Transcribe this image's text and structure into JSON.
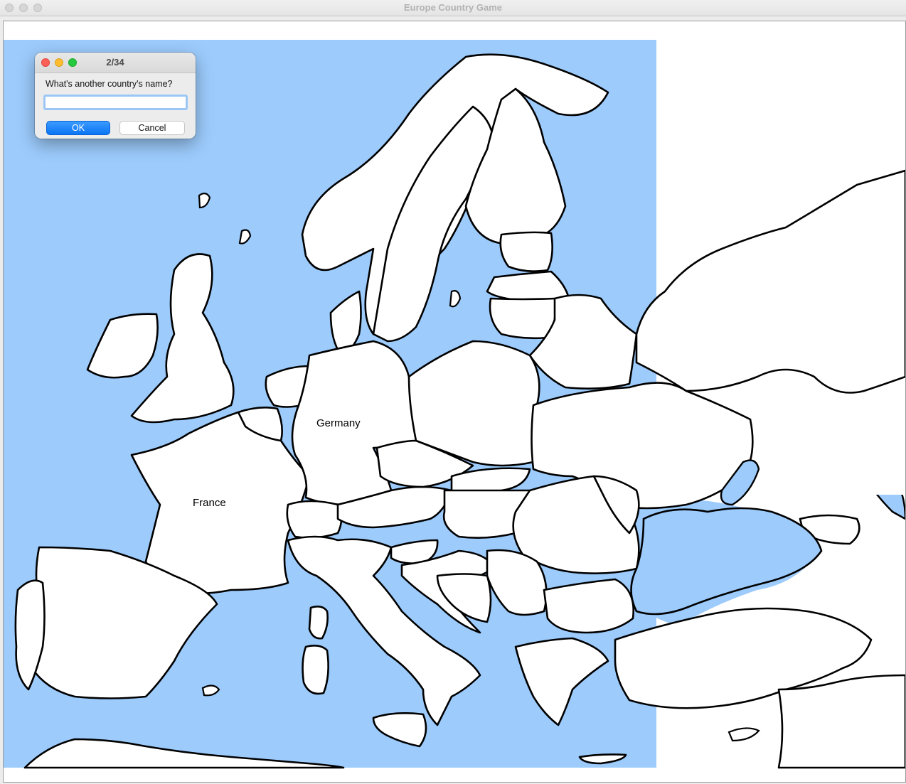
{
  "window": {
    "title": "Europe Country Game"
  },
  "map": {
    "sea_color": "#9ccbfc",
    "land_color": "#ffffff",
    "border_color": "#000000",
    "labeled_countries": [
      {
        "name": "Germany"
      },
      {
        "name": "France"
      }
    ]
  },
  "dialog": {
    "title": "2/34",
    "prompt": "What's another country's name?",
    "input_value": "",
    "ok_label": "OK",
    "cancel_label": "Cancel"
  },
  "colors": {
    "ok_button": "#0a74f4",
    "close_light": "#fe5f57",
    "minimize_light": "#febc2e",
    "zoom_light": "#28c840"
  }
}
